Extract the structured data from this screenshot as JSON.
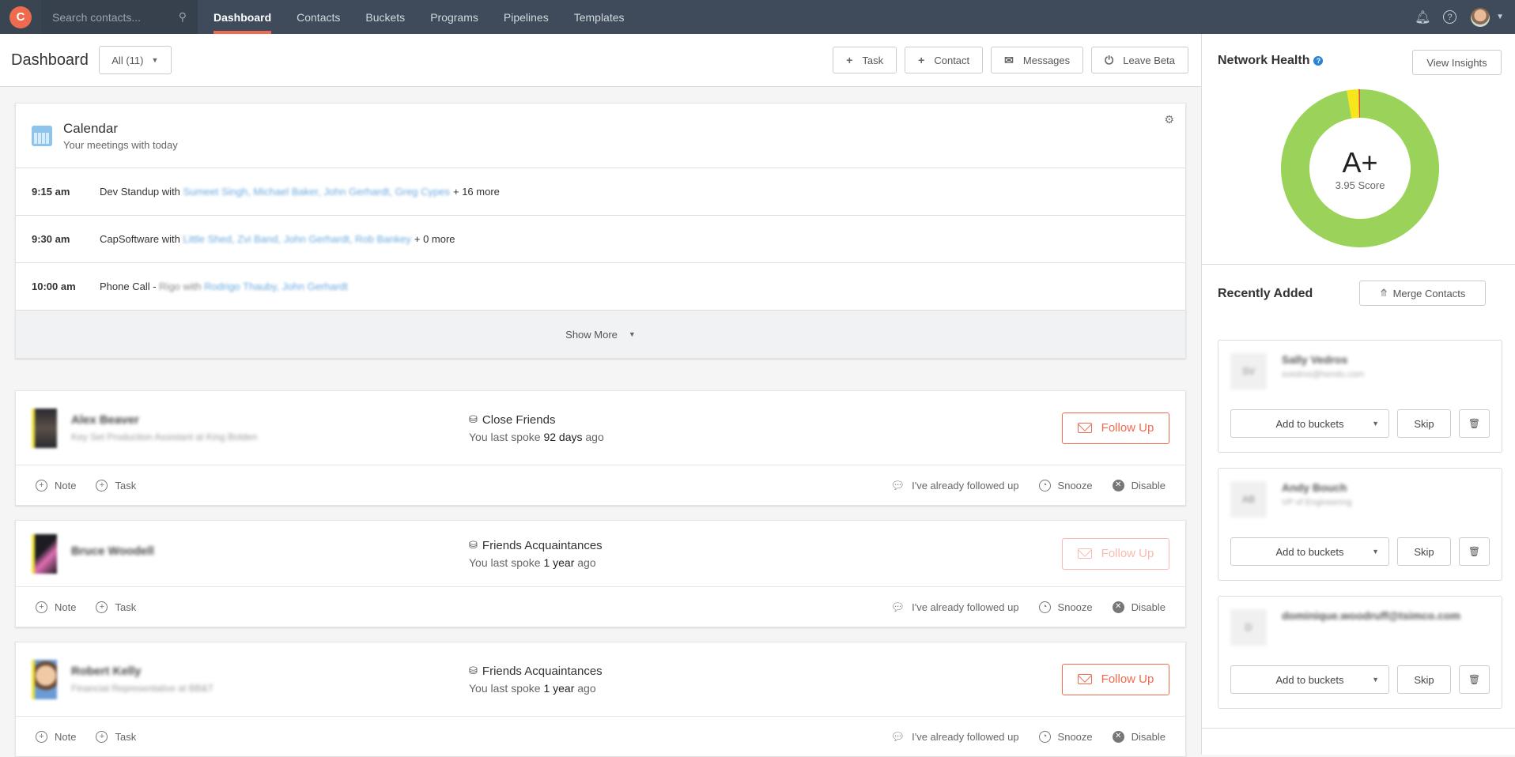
{
  "topbar": {
    "logo_glyph": "C",
    "search_placeholder": "Search contacts...",
    "nav": [
      {
        "label": "Dashboard",
        "active": true
      },
      {
        "label": "Contacts"
      },
      {
        "label": "Buckets"
      },
      {
        "label": "Programs"
      },
      {
        "label": "Pipelines"
      },
      {
        "label": "Templates"
      }
    ],
    "icons": {
      "notifications": "bell-icon",
      "help": "help-circle-icon",
      "profile": "avatar",
      "menu": "caret-down-icon"
    }
  },
  "header": {
    "title": "Dashboard",
    "filter": "All (11)",
    "actions": [
      {
        "icon": "+",
        "label": "Task"
      },
      {
        "icon": "+",
        "label": "Contact"
      },
      {
        "icon": "✉",
        "label": "Messages"
      },
      {
        "icon": "⏻",
        "label": "Leave Beta"
      }
    ]
  },
  "calendar": {
    "title": "Calendar",
    "subtitle": "Your meetings with today",
    "meetings": [
      {
        "time": "9:15 am",
        "title": "Dev Standup",
        "with": "with",
        "attendees": "Sumeet Singh, Michael Baker, John Gerhardt, Greg Cypes",
        "more": "+ 16 more"
      },
      {
        "time": "9:30 am",
        "title": "CapSoftware",
        "with": "with",
        "attendees": "Little Shed, Zvi Band, John Gerhardt, Rob Bankey",
        "more": "+ 0 more"
      },
      {
        "time": "10:00 am",
        "title": "Phone Call -",
        "hidden": "Rigo with",
        "attendees": "Rodrigo Thauby, John Gerhardt",
        "more": ""
      }
    ],
    "show_more": "Show More"
  },
  "followups": [
    {
      "name": "Alex Beaver",
      "role": "Key Set Production Assistant at King Bolden",
      "bucket": "Close Friends",
      "spoke_prefix": "You last spoke",
      "spoke_value": "92 days",
      "spoke_suffix": "ago",
      "follow_label": "Follow Up",
      "follow_enabled": true
    },
    {
      "name": "Bruce Woodell",
      "role": "",
      "bucket": "Friends Acquaintances",
      "spoke_prefix": "You last spoke",
      "spoke_value": "1 year",
      "spoke_suffix": "ago",
      "follow_label": "Follow Up",
      "follow_enabled": false
    },
    {
      "name": "Robert Kelly",
      "role": "Financial Representative at BB&T",
      "bucket": "Friends Acquaintances",
      "spoke_prefix": "You last spoke",
      "spoke_value": "1 year",
      "spoke_suffix": "ago",
      "follow_label": "Follow Up",
      "follow_enabled": true
    }
  ],
  "followup_actions": {
    "note": "Note",
    "task": "Task",
    "followed": "I've already followed up",
    "snooze": "Snooze",
    "disable": "Disable"
  },
  "network_health": {
    "title": "Network Health",
    "view_insights": "View Insights",
    "grade": "A+",
    "score": "3.95 Score",
    "segments": [
      {
        "name": "good",
        "percent": 97.3,
        "color": "#9bd35a"
      },
      {
        "name": "warning",
        "percent": 2.4,
        "color": "#f6e61a"
      },
      {
        "name": "bad",
        "percent": 0.3,
        "color": "#e2533a"
      }
    ]
  },
  "recently_added": {
    "title": "Recently Added",
    "merge_label": "Merge Contacts",
    "add_label": "Add to buckets",
    "skip_label": "Skip",
    "contacts": [
      {
        "initials": "SV",
        "name": "Sally Vedros",
        "sub": "svedros@hendu.com"
      },
      {
        "initials": "AB",
        "name": "Andy Bouch",
        "sub": "VP of Engineering"
      },
      {
        "initials": "D",
        "name": "dominique.woodruff@tsimco.com",
        "sub": ""
      }
    ]
  }
}
